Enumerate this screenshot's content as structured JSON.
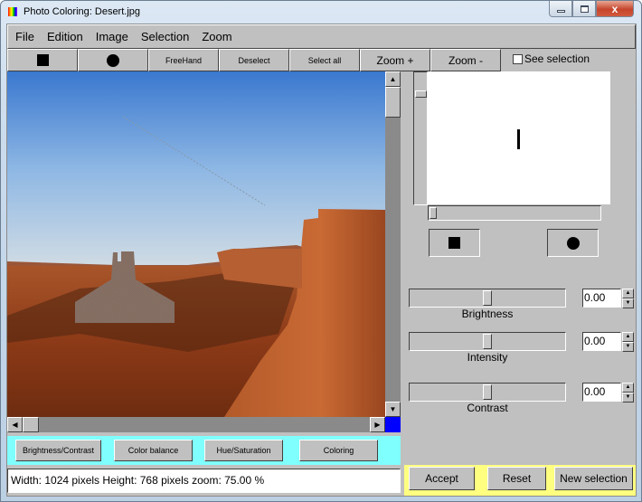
{
  "window": {
    "title": "Photo Coloring: Desert.jpg",
    "close_glyph": "x"
  },
  "menu": [
    "File",
    "Edition",
    "Image",
    "Selection",
    "Zoom"
  ],
  "toolbar": {
    "rect_select_icon": "square-icon",
    "ellipse_select_icon": "circle-icon",
    "freehand": "FreeHand",
    "deselect": "Deselect",
    "select_all": "Select all",
    "zoom_in": "Zoom +",
    "zoom_out": "Zoom -",
    "see_selection": "See selection",
    "see_selection_checked": false
  },
  "scroll": {
    "up": "▲",
    "down": "▼",
    "left": "◀",
    "right": "▶"
  },
  "actions": {
    "brightness_contrast": "Brightness/Contrast",
    "color_balance": "Color balance",
    "hue_saturation": "Hue/Saturation",
    "coloring": "Coloring"
  },
  "status": {
    "text": "Width: 1024 pixels Height: 768 pixels zoom: 75.00 %"
  },
  "adjustments": [
    {
      "label": "Brightness",
      "value": "0.00",
      "slider_fraction": 0.5
    },
    {
      "label": "Intensity",
      "value": "0.00",
      "slider_fraction": 0.5
    },
    {
      "label": "Contrast",
      "value": "0.00",
      "slider_fraction": 0.5
    }
  ],
  "spin": {
    "up": "▲",
    "down": "▼"
  },
  "buttons": {
    "accept": "Accept",
    "reset": "Reset",
    "new_selection": "New selection"
  },
  "colors": {
    "actions_bar": "#80ffff",
    "bottom_bar": "#ffff80",
    "corner": "#0000ff"
  }
}
